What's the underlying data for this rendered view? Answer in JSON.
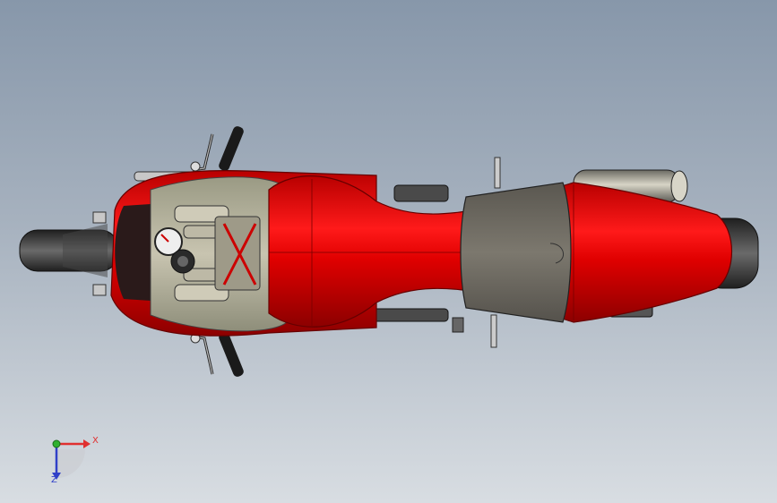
{
  "viewport": {
    "background_top": "#8797aa",
    "background_bottom": "#d8dde2"
  },
  "model": {
    "name_icon": "motorcycle-top-view",
    "body_color": "#e00000",
    "seat_color": "#6e6a62",
    "tire_color": "#3a3a3a"
  },
  "triad": {
    "x_label": "X",
    "z_label": "Z",
    "x_color": "#e03030",
    "y_color": "#30b030",
    "z_color": "#3040c8"
  }
}
